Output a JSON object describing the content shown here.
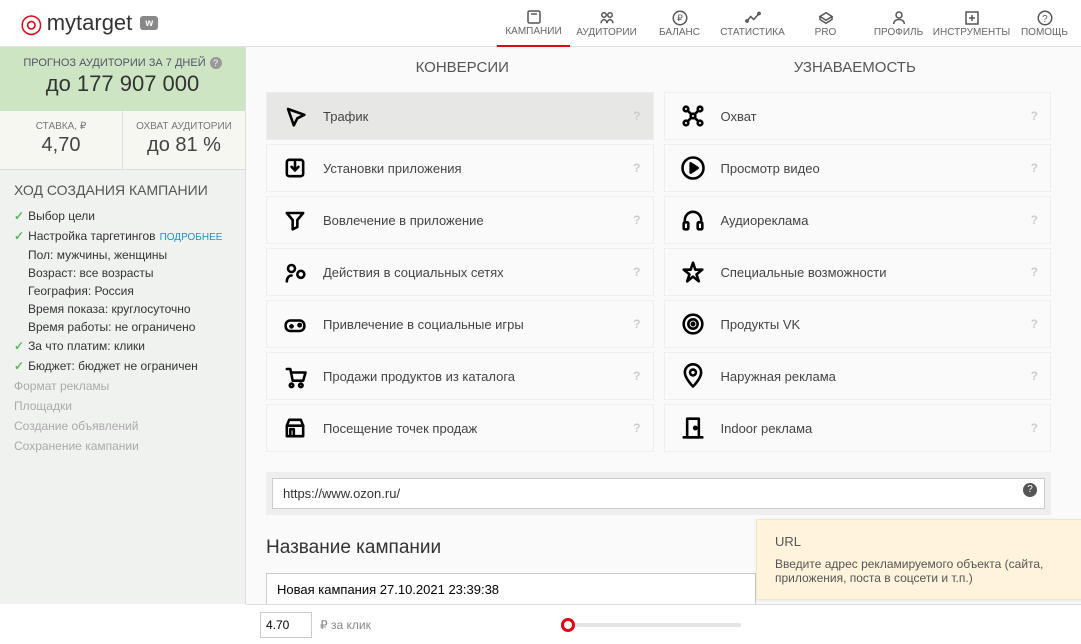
{
  "logo": {
    "brand_a": "my",
    "brand_b": "target"
  },
  "topnav": [
    {
      "label": "КАМПАНИИ",
      "active": true
    },
    {
      "label": "АУДИТОРИИ"
    },
    {
      "label": "БАЛАНС"
    },
    {
      "label": "СТАТИСТИКА"
    },
    {
      "label": "PRO"
    },
    {
      "label": "ПРОФИЛЬ"
    },
    {
      "label": "ИНСТРУМЕНТЫ"
    },
    {
      "label": "ПОМОЩЬ"
    }
  ],
  "forecast": {
    "label": "ПРОГНОЗ АУДИТОРИИ ЗА 7 ДНЕЙ",
    "value": "до 177 907 000"
  },
  "stats": {
    "bid_label": "СТАВКА, ₽",
    "bid_value": "4,70",
    "reach_label": "ОХВАТ АУДИТОРИИ",
    "reach_value": "до 81 %"
  },
  "progress": {
    "title": "ХОД СОЗДАНИЯ КАМПАНИИ",
    "steps": [
      {
        "label": "Выбор цели",
        "done": true
      },
      {
        "label": "Настройка таргетингов",
        "done": true,
        "more": "ПОДРОБНЕЕ"
      },
      {
        "label": "За что платим: клики",
        "done": true
      },
      {
        "label": "Бюджет: бюджет не ограничен",
        "done": true
      },
      {
        "label": "Формат рекламы",
        "disabled": true
      },
      {
        "label": "Площадки",
        "disabled": true
      },
      {
        "label": "Создание объявлений",
        "disabled": true
      },
      {
        "label": "Сохранение кампании",
        "disabled": true
      }
    ],
    "subs": [
      "Пол: мужчины, женщины",
      "Возраст: все возрасты",
      "География: Россия",
      "Время показа: круглосуточно",
      "Время работы: не ограничено"
    ]
  },
  "goals": {
    "header_left": "КОНВЕРСИИ",
    "header_right": "УЗНАВАЕМОСТЬ",
    "left": [
      {
        "label": "Трафик",
        "selected": true,
        "icon": "cursor"
      },
      {
        "label": "Установки приложения",
        "icon": "download"
      },
      {
        "label": "Вовлечение в приложение",
        "icon": "funnel"
      },
      {
        "label": "Действия в социальных сетях",
        "icon": "social"
      },
      {
        "label": "Привлечение в социальные игры",
        "icon": "gamepad"
      },
      {
        "label": "Продажи продуктов из каталога",
        "icon": "cart"
      },
      {
        "label": "Посещение точек продаж",
        "icon": "store"
      }
    ],
    "right": [
      {
        "label": "Охват",
        "icon": "network"
      },
      {
        "label": "Просмотр видео",
        "icon": "play"
      },
      {
        "label": "Аудиореклама",
        "icon": "headphones"
      },
      {
        "label": "Специальные возможности",
        "icon": "star"
      },
      {
        "label": "Продукты VK",
        "icon": "target"
      },
      {
        "label": "Наружная реклама",
        "icon": "pin"
      },
      {
        "label": "Indoor реклама",
        "icon": "door"
      }
    ]
  },
  "url": {
    "value": "https://www.ozon.ru/"
  },
  "campaign": {
    "title": "Название кампании",
    "name": "Новая кампания 27.10.2021 23:39:38"
  },
  "tooltip": {
    "title": "URL",
    "body": "Введите адрес рекламируемого объекта (сайта, приложения, поста в соцсети и т.п.)"
  },
  "bottombar": {
    "bid": "4.70",
    "unit": "₽ за клик"
  }
}
